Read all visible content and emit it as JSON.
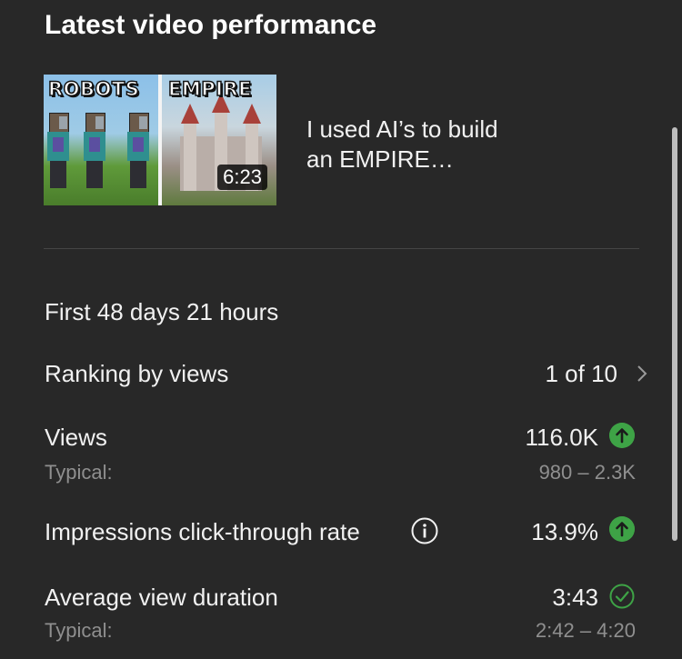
{
  "header": {
    "title": "Latest video performance"
  },
  "video": {
    "thumbnail_left_text": "ROBOTS",
    "thumbnail_right_text": "EMPIRE",
    "duration": "6:23",
    "title_line1": "I used AI’s to build",
    "title_line2": "an EMPIRE…"
  },
  "period": "First 48 days 21 hours",
  "metrics": {
    "ranking": {
      "label": "Ranking by views",
      "value": "1 of 10"
    },
    "views": {
      "label": "Views",
      "value": "116.0K",
      "typical_label": "Typical:",
      "typical_value": "980 – 2.3K",
      "status_icon": "arrow-up-circle"
    },
    "ctr": {
      "label": "Impressions click-through rate",
      "value": "13.9%",
      "status_icon": "arrow-up-circle",
      "info_icon": "info-icon"
    },
    "avd": {
      "label": "Average view duration",
      "value": "3:43",
      "typical_label": "Typical:",
      "typical_value": "2:42 – 4:20",
      "status_icon": "check-circle"
    }
  },
  "colors": {
    "background": "#282828",
    "accent_green": "#3ea346",
    "muted_text": "#8f8f8f"
  }
}
